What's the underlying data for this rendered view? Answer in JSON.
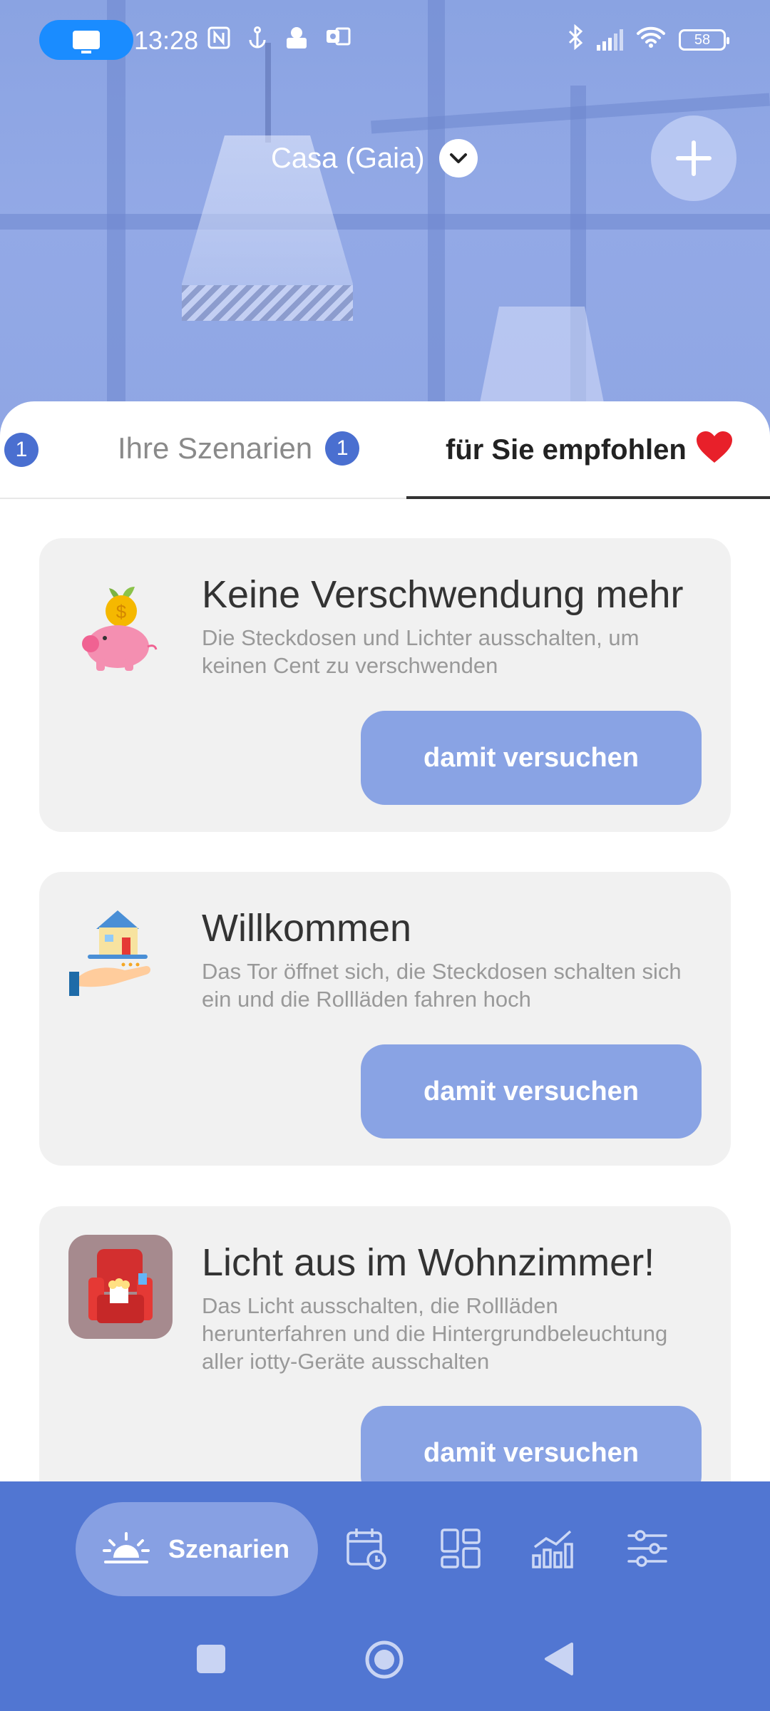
{
  "status_bar": {
    "time": "13:28",
    "battery": "58"
  },
  "header": {
    "home_name": "Casa (Gaia)"
  },
  "tabs": {
    "left_partial_badge": "1",
    "yours": {
      "label": "Ihre Szenarien",
      "badge": "1"
    },
    "recommended": {
      "label": "für Sie empfohlen"
    }
  },
  "cards": [
    {
      "title": "Keine Verschwendung mehr",
      "description": "Die Steckdosen und Lichter ausschalten, um keinen Cent zu verschwenden",
      "button": "damit versuchen",
      "icon": "piggy-bank-icon"
    },
    {
      "title": "Willkommen",
      "description": "Das Tor öffnet sich, die Steckdosen schalten sich ein und die Rollläden fahren hoch",
      "button": "damit versuchen",
      "icon": "house-in-hand-icon"
    },
    {
      "title": "Licht aus im Wohnzimmer!",
      "description": "Das Licht ausschalten, die Rollläden herunterfahren und die Hintergrundbeleuchtung aller iotty-Geräte ausschalten",
      "button": "damit versuchen",
      "icon": "armchair-popcorn-icon"
    }
  ],
  "bottom_nav": {
    "active_label": "Szenarien",
    "items": [
      "scenarios-icon",
      "calendar-clock-icon",
      "dashboard-icon",
      "statistics-icon",
      "settings-sliders-icon"
    ]
  },
  "colors": {
    "accent": "#5176d2",
    "button": "#89a3e4",
    "badge": "#4a6fd0",
    "heart": "#e8202a",
    "card_bg": "#f1f1f1"
  }
}
